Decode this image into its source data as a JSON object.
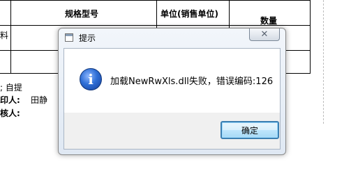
{
  "document": {
    "headers": {
      "spec_model": "规格型号",
      "unit": "单位(销售单位)",
      "quantity": "数量"
    },
    "row_fragment": "料",
    "footer": {
      "line1": "; 自提",
      "printer_label": "印人:",
      "printer_name": "田静",
      "reviewer_label": "核人:"
    }
  },
  "dialog": {
    "title": "提示",
    "close_glyph": "✕",
    "message": "加载NewRwXls.dll失败，错误编码:126",
    "ok_label": "确定",
    "icon": "info-icon"
  }
}
